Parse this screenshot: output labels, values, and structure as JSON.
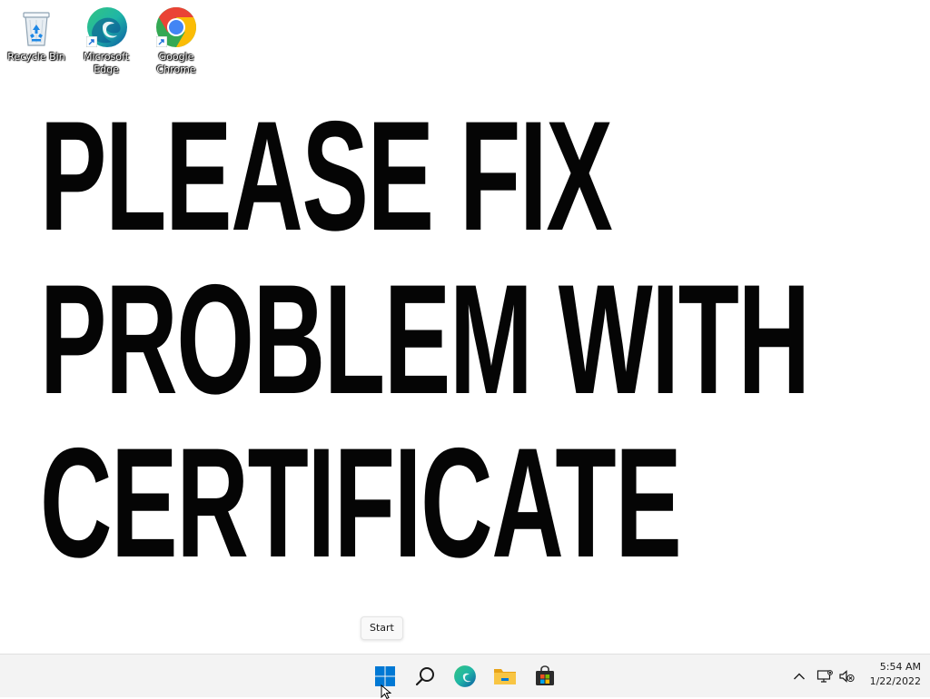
{
  "desktop": {
    "icons": [
      {
        "label": "Recycle Bin",
        "icon": "recycle-bin-icon"
      },
      {
        "label": "Microsoft Edge",
        "icon": "edge-icon"
      },
      {
        "label": "Google Chrome",
        "icon": "chrome-icon"
      }
    ],
    "wallpaper_text": [
      "PLEASE FIX",
      "PROBLEM WITH",
      "CERTIFICATE"
    ]
  },
  "tooltip": {
    "text": "Start"
  },
  "taskbar": {
    "pinned": [
      {
        "name": "start-button",
        "icon": "windows-logo-icon"
      },
      {
        "name": "search-button",
        "icon": "search-icon"
      },
      {
        "name": "edge-taskbar-button",
        "icon": "edge-icon"
      },
      {
        "name": "file-explorer-button",
        "icon": "folder-icon"
      },
      {
        "name": "microsoft-store-button",
        "icon": "store-icon"
      }
    ],
    "tray": {
      "icons": [
        "chevron-up-icon",
        "network-icon",
        "volume-muted-icon"
      ],
      "time": "5:54 AM",
      "date": "1/22/2022"
    }
  },
  "colors": {
    "windows_blue": "#0078d4",
    "edge_teal": "#1fb6a6",
    "chrome_red": "#ea4335",
    "chrome_yellow": "#fbbc05",
    "chrome_green": "#34a853",
    "folder_yellow": "#f8c543",
    "taskbar_bg": "#f3f3f3"
  }
}
